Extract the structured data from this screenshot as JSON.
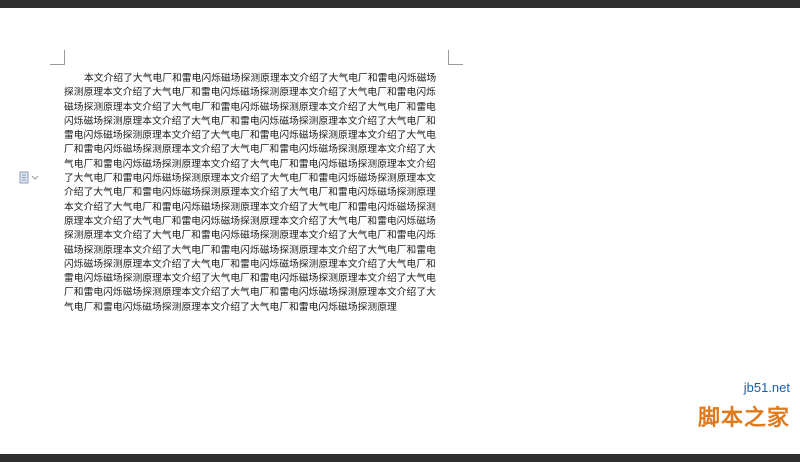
{
  "document": {
    "body_text": "本文介绍了大气电厂和雷电闪烁磁场探测原理本文介绍了大气电厂和雷电闪烁磁场探测原理本文介绍了大气电厂和雷电闪烁磁场探测原理本文介绍了大气电厂和雷电闪烁磁场探测原理本文介绍了大气电厂和雷电闪烁磁场探测原理本文介绍了大气电厂和雷电闪烁磁场探测原理本文介绍了大气电厂和雷电闪烁磁场探测原理本文介绍了大气电厂和雷电闪烁磁场探测原理本文介绍了大气电厂和雷电闪烁磁场探测原理本文介绍了大气电厂和雷电闪烁磁场探测原理本文介绍了大气电厂和雷电闪烁磁场探测原理本文介绍了大气电厂和雷电闪烁磁场探测原理本文介绍了大气电厂和雷电闪烁磁场探测原理本文介绍了大气电厂和雷电闪烁磁场探测原理本文介绍了大气电厂和雷电闪烁磁场探测原理本文介绍了大气电厂和雷电闪烁磁场探测原理本文介绍了大气电厂和雷电闪烁磁场探测原理本文介绍了大气电厂和雷电闪烁磁场探测原理本文介绍了大气电厂和雷电闪烁磁场探测原理本文介绍了大气电厂和雷电闪烁磁场探测原理本文介绍了大气电厂和雷电闪烁磁场探测原理本文介绍了大气电厂和雷电闪烁磁场探测原理本文介绍了大气电厂和雷电闪烁磁场探测原理本文介绍了大气电厂和雷电闪烁磁场探测原理本文介绍了大气电厂和雷电闪烁磁场探测原理本文介绍了大气电厂和雷电闪烁磁场探测原理本文介绍了大气电厂和雷电闪烁磁场探测原理本文介绍了大气电厂和雷电闪烁磁场探测原理本文介绍了大气电厂和雷电闪烁磁场探测原理本文介绍了大气电厂和雷电闪烁磁场探测原理本文介绍了大气电厂和雷电闪烁磁场探测原理本文介绍了大气电厂和雷电闪烁磁场探测原理"
  },
  "icons": {
    "paragraph_marker": "paragraph-layout-icon"
  },
  "watermark": {
    "site": "jb51.net",
    "name": "脚本之家"
  }
}
